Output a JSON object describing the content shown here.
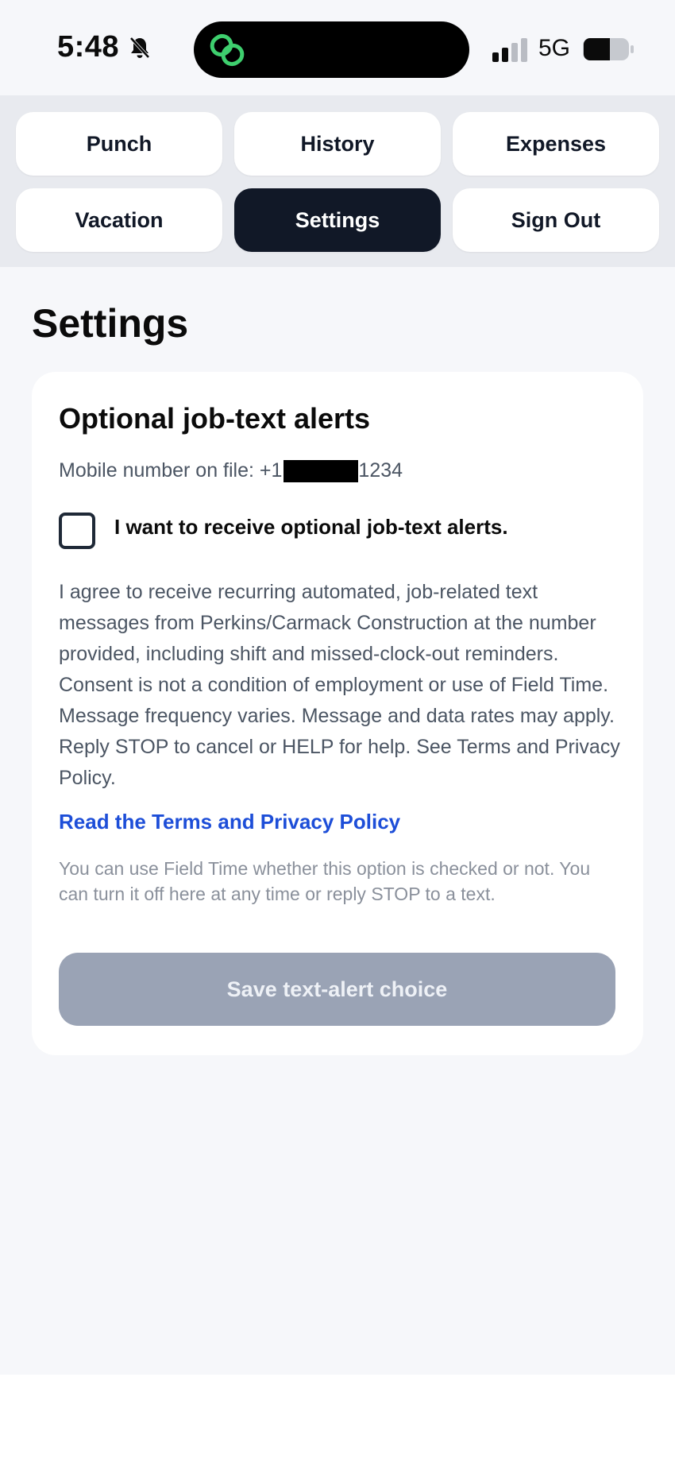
{
  "status_bar": {
    "time": "5:48",
    "network": "5G",
    "icons": [
      "bell-off-icon",
      "link-icon",
      "signal-icon",
      "battery-icon"
    ],
    "link_icon_color": "#3ecf6e"
  },
  "nav": {
    "punch": "Punch",
    "history": "History",
    "expenses": "Expenses",
    "vacation": "Vacation",
    "settings": "Settings",
    "sign_out": "Sign Out",
    "active": "Settings"
  },
  "page": {
    "title": "Settings"
  },
  "alerts_card": {
    "title": "Optional job-text alerts",
    "mobile_prefix": "Mobile number on file: +1",
    "mobile_suffix": "1234",
    "checkbox_checked": false,
    "checkbox_label": "I want to receive optional job-text alerts.",
    "consent_text": "I agree to receive recurring automated, job-related text messages from Perkins/Carmack Construction at the number provided, including shift and missed-clock-out reminders. Consent is not a condition of employment or use of Field Time. Message frequency varies. Message and data rates may apply. Reply STOP to cancel or HELP for help. See Terms and Privacy Policy.",
    "terms_link": "Read the Terms and Privacy Policy",
    "help_note": "You can use Field Time whether this option is checked or not. You can turn it off here at any time or reply STOP to a text.",
    "save_label": "Save text-alert choice"
  },
  "colors": {
    "active_nav": "#111827",
    "link": "#1d4ed8",
    "disabled_button": "#9aa3b5"
  }
}
